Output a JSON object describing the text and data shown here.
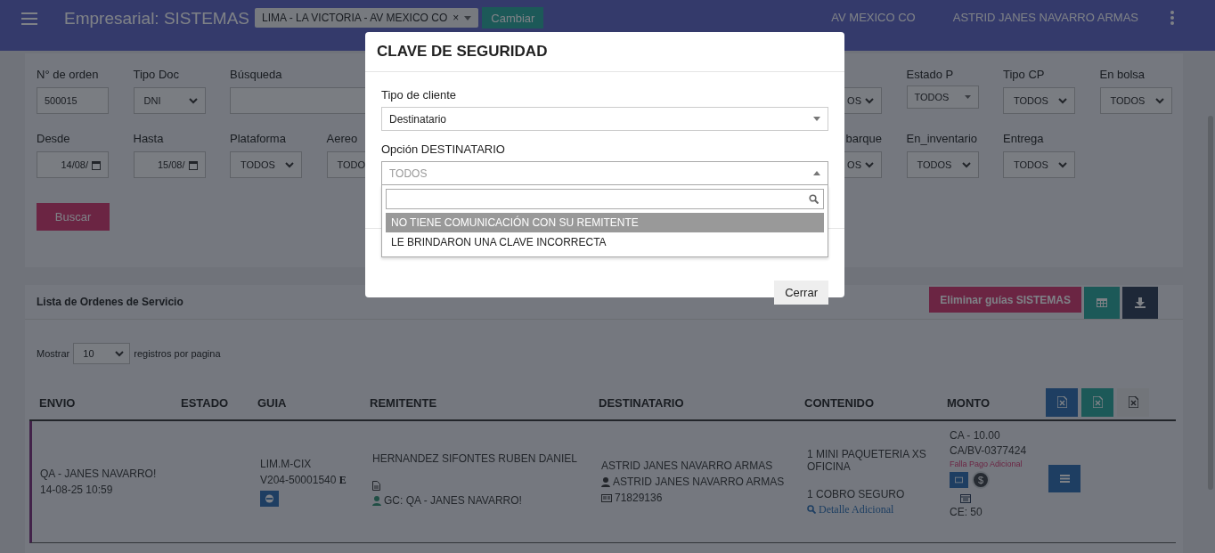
{
  "header": {
    "title": "Empresarial: SISTEMAS",
    "branch": {
      "value": "LIMA - LA VICTORIA - AV MEXICO CO",
      "clear": "×"
    },
    "change_button": "Cambiar",
    "agency": "AV MEXICO CO",
    "user": "ASTRID JANES NAVARRO ARMAS"
  },
  "filters": {
    "rows": [
      {
        "left": [
          {
            "label": "N° de orden",
            "kind": "input",
            "value": "500015"
          },
          {
            "label": "Tipo Doc",
            "kind": "select",
            "value": "DNI"
          },
          {
            "label": "Búsqueda",
            "kind": "search"
          }
        ],
        "right": [
          {
            "kind": "select-cut",
            "value": "OS"
          },
          {
            "label": "Estado P",
            "kind": "combo",
            "value": "TODOS"
          },
          {
            "label": "Tipo CP",
            "kind": "select",
            "value": "TODOS"
          },
          {
            "label": "En bolsa",
            "kind": "select",
            "value": "TODOS"
          }
        ]
      },
      {
        "left": [
          {
            "label": "Desde",
            "kind": "date",
            "value": "14/08/"
          },
          {
            "label": "Hasta",
            "kind": "date",
            "value": "15/08/"
          },
          {
            "label": "Plataforma",
            "kind": "select",
            "value": "TODOS"
          },
          {
            "label": "Aereo",
            "kind": "select-covered",
            "value": "TODO"
          }
        ],
        "right": [
          {
            "label": "barque",
            "kind": "select-cut",
            "value": "OS"
          },
          {
            "label": "En_inventario",
            "kind": "select",
            "value": "TODOS"
          },
          {
            "label": "Entrega",
            "kind": "select",
            "value": "TODOS"
          }
        ]
      }
    ],
    "search_button": "Buscar"
  },
  "list": {
    "title": "Lista de Ordenes de Servicio",
    "delete_button": "Eliminar guías SISTEMAS",
    "show_label": "Mostrar",
    "page_size": "10",
    "per_page_label": "registros por pagina",
    "columns": [
      "ENVIO",
      "ESTADO",
      "GUIA",
      "REMITENTE",
      "DESTINATARIO",
      "CONTENIDO",
      "MONTO"
    ],
    "rows": [
      {
        "sender": "QA - JANES NAVARRO!",
        "date": "14-08-25 10:59",
        "guide": [
          "LIM.M-CIX",
          "V204-50001540 **E**"
        ],
        "remitente": {
          "name": "HERNANDEZ SIFONTES RUBEN DANIEL",
          "contact": "GC: QA - JANES NAVARRO!"
        },
        "destinatario": {
          "name": "ASTRID JANES NAVARRO ARMAS",
          "contact": "ASTRID JANES NAVARRO ARMAS",
          "document": "71829136"
        },
        "contenido": {
          "items": [
            "1 MINI PAQUETERIA XS OFICINA",
            "1 COBRO SEGURO"
          ],
          "link": "Detalle Adicional"
        },
        "monto": {
          "lines": [
            "CA - 10.00",
            "CA/BV-0377424"
          ],
          "alert": "Falla Pago Adicional",
          "currency_symbol": "$",
          "footer": "CE: 50"
        }
      }
    ]
  },
  "dialog": {
    "title": "CLAVE DE SEGURIDAD",
    "fields": [
      {
        "label": "Tipo de cliente",
        "value": "Destinatario",
        "expanded": false
      },
      {
        "label": "Opción DESTINATARIO",
        "placeholder": "TODOS",
        "expanded": true
      }
    ],
    "options": [
      {
        "label": "NO TIENE COMUNICACIÓN CON SU REMITENTE",
        "selected": true
      },
      {
        "label": "LE BRINDARON UNA CLAVE INCORRECTA",
        "selected": false
      }
    ],
    "close_button": "Cerrar"
  }
}
